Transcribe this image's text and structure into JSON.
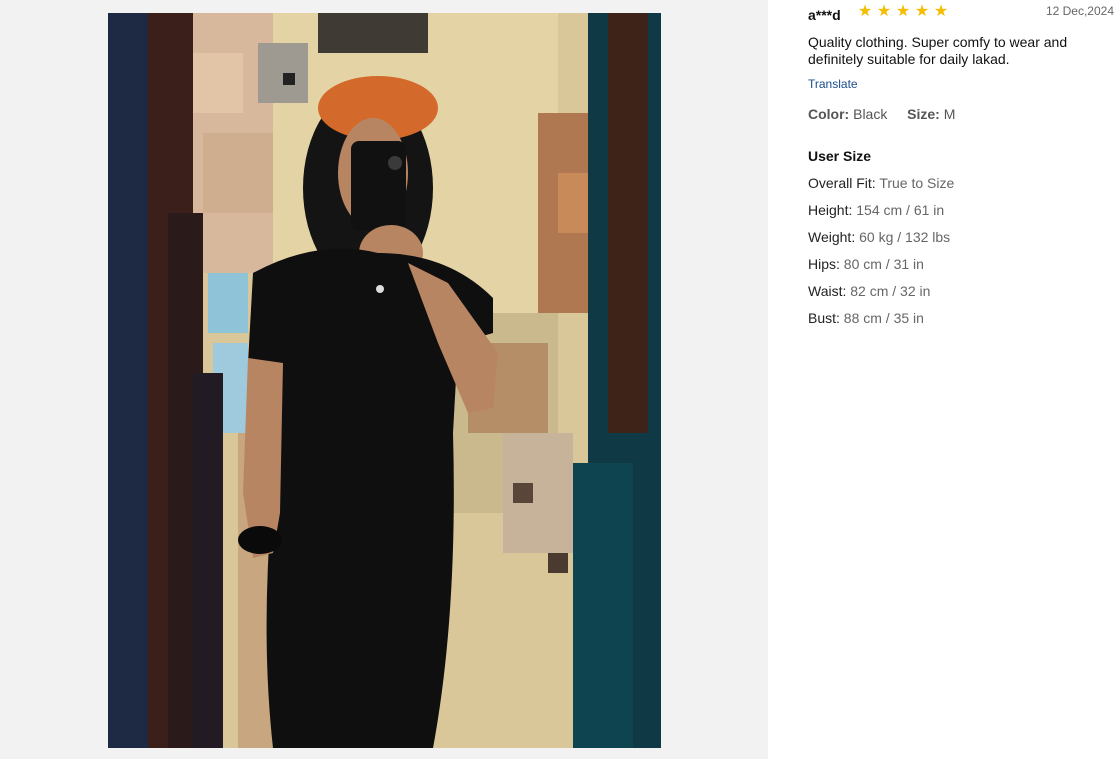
{
  "review": {
    "username": "a***d",
    "rating": 5,
    "stars": [
      "star-icon",
      "star-icon",
      "star-icon",
      "star-icon",
      "star-icon"
    ],
    "date": "12 Dec,2024",
    "text": "Quality clothing. Super comfy to wear and definitely suitable for daily lakad.",
    "translate_label": "Translate",
    "color_label": "Color:",
    "color_value": "Black",
    "size_label": "Size:",
    "size_value": "M"
  },
  "user_size": {
    "title": "User Size",
    "items": [
      {
        "label": "Overall Fit:",
        "value": "True to Size"
      },
      {
        "label": "Height:",
        "value": "154 cm / 61 in"
      },
      {
        "label": "Weight:",
        "value": "60 kg / 132 lbs"
      },
      {
        "label": "Hips:",
        "value": "80 cm / 31 in"
      },
      {
        "label": "Waist:",
        "value": "82 cm / 32 in"
      },
      {
        "label": "Bust:",
        "value": "88 cm / 35 in"
      }
    ]
  },
  "colors": {
    "star": "#f5bd00",
    "link": "#1a4d8f",
    "panel_bg": "#f2f2f2"
  }
}
